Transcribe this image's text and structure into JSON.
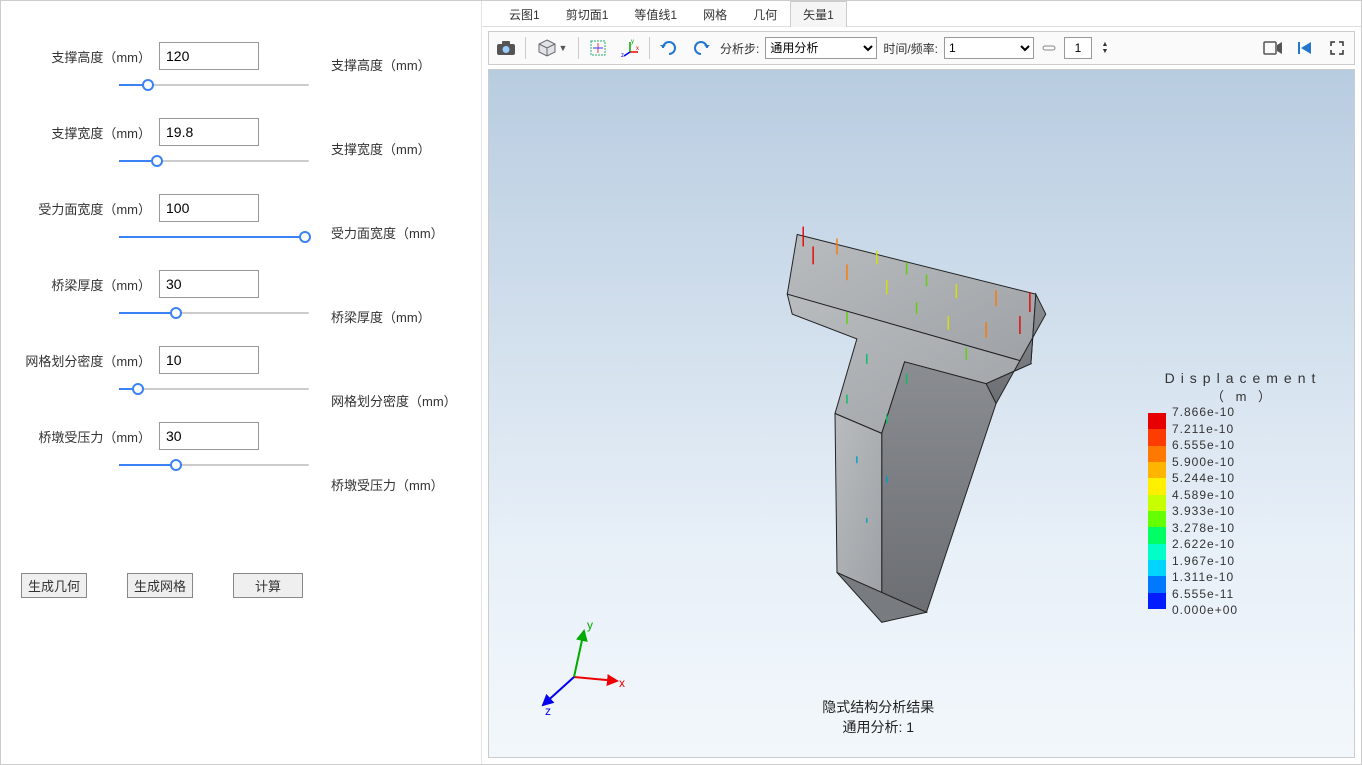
{
  "params": [
    {
      "label": "支撑高度（mm）",
      "label2": "支撑高度（mm）",
      "value": "120",
      "fill": 15
    },
    {
      "label": "支撑宽度（mm）",
      "label2": "支撑宽度（mm）",
      "value": "19.8",
      "fill": 20
    },
    {
      "label": "受力面宽度（mm）",
      "label2": "受力面宽度（mm）",
      "value": "100",
      "fill": 98
    },
    {
      "label": "桥梁厚度（mm）",
      "label2": "桥梁厚度（mm）",
      "value": "30",
      "fill": 30
    },
    {
      "label": "网格划分密度（mm）",
      "label2": "网格划分密度（mm）",
      "value": "10",
      "fill": 10
    },
    {
      "label": "桥墩受压力（mm）",
      "label2": "桥墩受压力（mm）",
      "value": "30",
      "fill": 30
    }
  ],
  "buttons": {
    "gen_geom": "生成几何",
    "gen_mesh": "生成网格",
    "compute": "计算"
  },
  "tabs": [
    "云图1",
    "剪切面1",
    "等值线1",
    "网格",
    "几何",
    "矢量1"
  ],
  "active_tab": 5,
  "toolbar": {
    "step_label": "分析步:",
    "step_select": "通用分析",
    "time_label": "时间/频率:",
    "time_select": "1",
    "numbox": "1"
  },
  "viewport": {
    "caption_line1": "隐式结构分析结果",
    "caption_line2": "通用分析: 1",
    "legend_title": "Displacement",
    "legend_unit": "（ m ）",
    "legend_values": [
      "7.866e-10",
      "7.211e-10",
      "6.555e-10",
      "5.900e-10",
      "5.244e-10",
      "4.589e-10",
      "3.933e-10",
      "3.278e-10",
      "2.622e-10",
      "1.967e-10",
      "1.311e-10",
      "6.555e-11",
      "0.000e+00"
    ],
    "legend_colors": [
      "#e60000",
      "#ff3c00",
      "#ff7800",
      "#ffb400",
      "#fff000",
      "#c8ff00",
      "#64ff00",
      "#00ff64",
      "#00ffc8",
      "#00d4ff",
      "#0078ff",
      "#001cff"
    ],
    "axes": {
      "x": "x",
      "y": "y",
      "z": "z"
    }
  }
}
